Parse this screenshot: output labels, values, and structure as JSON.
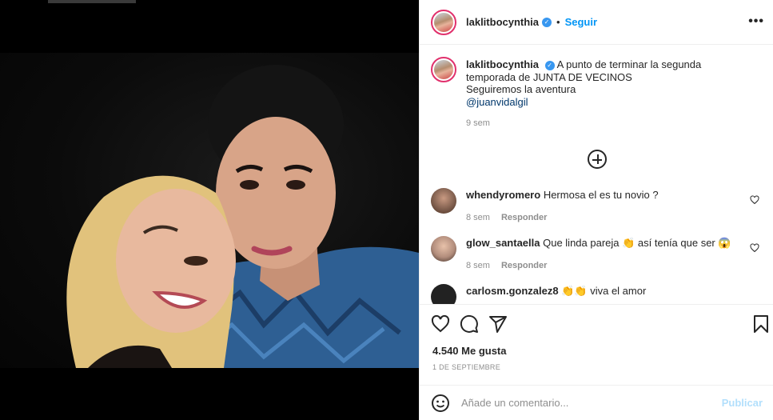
{
  "post": {
    "username": "laklitbocynthia",
    "follow_label": "Seguir",
    "more_label": "•••",
    "dot": "•",
    "verified_glyph": "✓"
  },
  "caption": {
    "username": "laklitbocynthia",
    "text": "A punto de terminar la segunda temporada de JUNTA DE VECINOS",
    "line2": "Seguiremos la aventura",
    "mention": "@juanvidalgil",
    "time": "9 sem"
  },
  "comments": [
    {
      "username": "whendyromero",
      "text": "Hermosa el es tu novio ?",
      "time": "8 sem",
      "reply": "Responder",
      "avatar_color": "#7a5a4a"
    },
    {
      "username": "glow_santaella",
      "text": "Que linda pareja 👏 así tenía que ser 😱",
      "time": "8 sem",
      "reply": "Responder",
      "avatar_color": "#b28d7c"
    },
    {
      "username": "carlosm.gonzalez8",
      "text": "👏👏 viva el amor",
      "time": "",
      "reply": "",
      "avatar_color": "#222222"
    }
  ],
  "actions": {
    "icons": [
      "heart-icon",
      "comment-icon",
      "share-icon",
      "bookmark-icon"
    ],
    "likes": "4.540 Me gusta",
    "date": "1 DE SEPTIEMBRE"
  },
  "add_comment": {
    "placeholder": "Añade un comentario...",
    "publish_label": "Publicar"
  },
  "colors": {
    "accent": "#0095f6",
    "verified": "#3897f0",
    "muted": "#8e8e8e"
  }
}
